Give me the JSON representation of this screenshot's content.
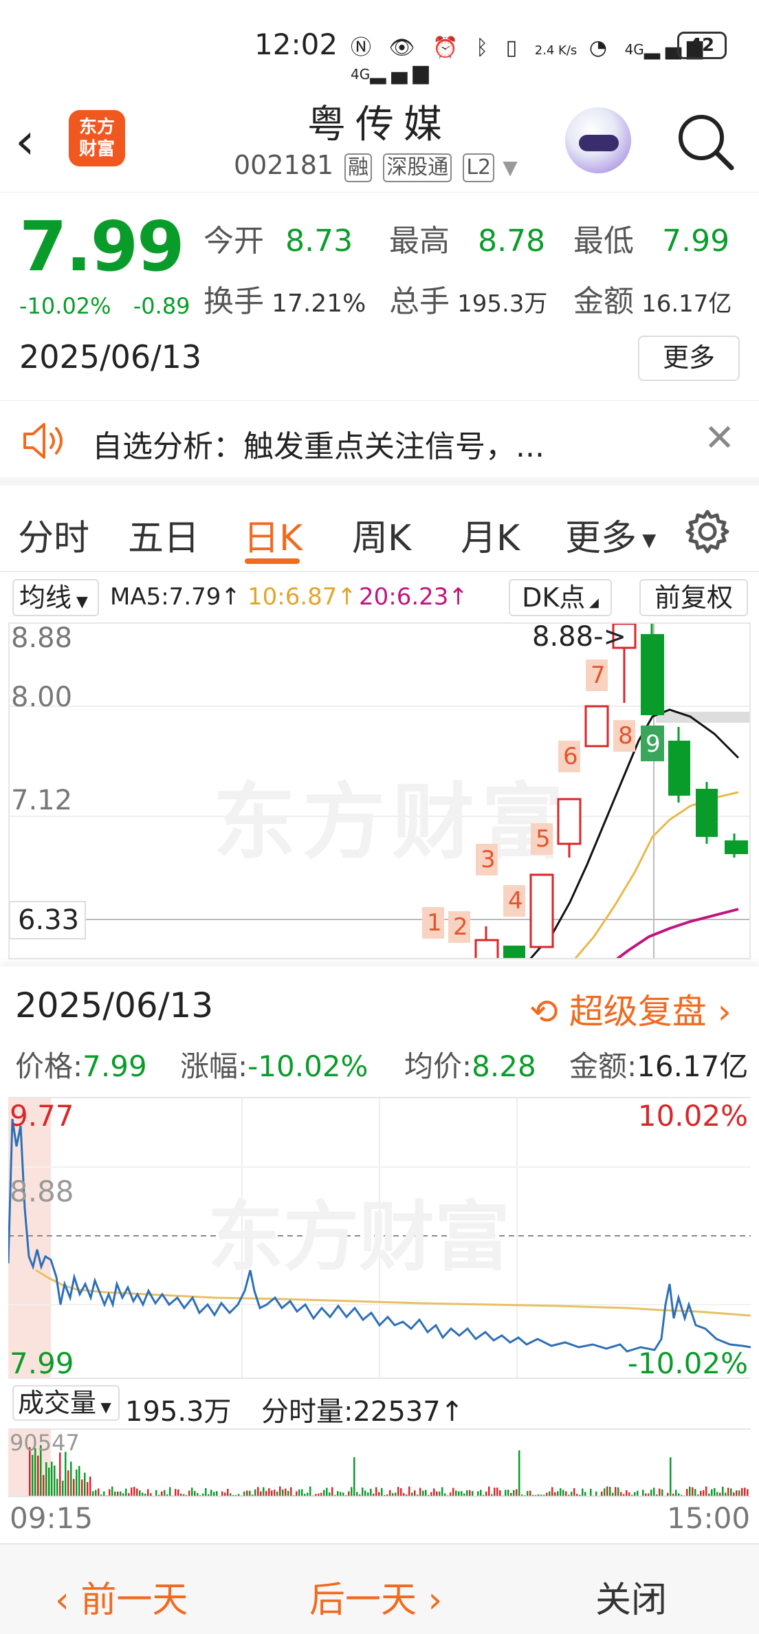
{
  "status_bar": {
    "time": "12:02",
    "net_speed": "2.4 K/s",
    "signal1": "4G",
    "signal2": "4G",
    "battery": "42"
  },
  "header": {
    "stock_name": "粤传媒",
    "stock_code": "002181",
    "tags": [
      "融",
      "深股通",
      "L2"
    ],
    "logo_text_line1": "东方",
    "logo_text_line2": "财富"
  },
  "quote": {
    "price": "7.99",
    "change_pct": "-10.02%",
    "change_amt": "-0.89",
    "open_label": "今开",
    "open": "8.73",
    "high_label": "最高",
    "high": "8.78",
    "low_label": "最低",
    "low": "7.99",
    "turnover_label": "换手",
    "turnover": "17.21%",
    "volume_label": "总手",
    "volume": "195.3万",
    "amount_label": "金额",
    "amount": "16.17亿",
    "date": "2025/06/13",
    "more_label": "更多"
  },
  "alert": {
    "text": "自选分析：触发重点关注信号，..."
  },
  "tabs": [
    "分时",
    "五日",
    "日K",
    "周K",
    "月K",
    "更多"
  ],
  "active_tab": "日K",
  "kline_toolbar": {
    "ma_select": "均线",
    "ma5": "MA5:7.79↑",
    "ma10": "10:6.87↑",
    "ma20": "20:6.23↑",
    "dk_label": "DK点",
    "fq_label": "前复权"
  },
  "kline": {
    "y_labels": [
      "8.88",
      "8.00",
      "7.12",
      "6.33"
    ],
    "max_annotation": "8.88->",
    "watermark": "东方财富",
    "signal_numbers": [
      "1",
      "2",
      "3",
      "4",
      "5",
      "6",
      "7",
      "8",
      "9"
    ],
    "colors": {
      "up": "#d9262a",
      "down": "#0a9c2a",
      "ma5": "#111111",
      "ma10": "#e8b84a",
      "ma20": "#c0157f",
      "signal": "#f6c9b4"
    }
  },
  "intraday": {
    "date": "2025/06/13",
    "replay_label": "超级复盘",
    "price_label": "价格:",
    "price": "7.99",
    "chg_label": "涨幅:",
    "chg": "-10.02%",
    "avg_label": "均价:",
    "avg": "8.28",
    "amount_label": "金额:",
    "amount": "16.17亿",
    "y_high": "9.77",
    "y_mid": "8.88",
    "y_low": "7.99",
    "pct_high": "10.02%",
    "pct_low": "-10.02%",
    "volume_select": "成交量",
    "volume_total": "195.3万",
    "tick_volume": "分时量:22537↑",
    "vol_max": "90547",
    "time_start": "09:15",
    "time_end": "15:00"
  },
  "bottom_nav": {
    "prev": "前一天",
    "next": "后一天",
    "close": "关闭"
  }
}
